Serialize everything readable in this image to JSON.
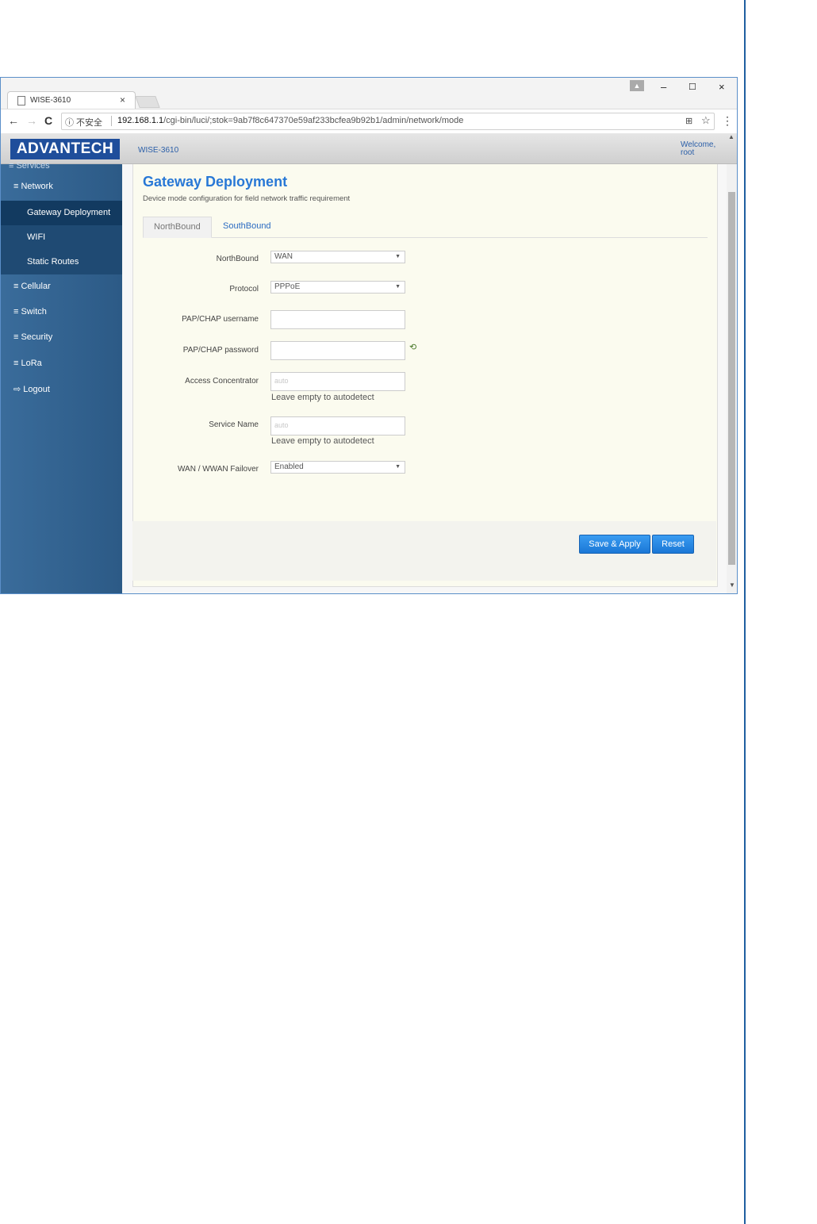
{
  "browser": {
    "tab_title": "WISE-3610",
    "tab_close": "×",
    "nav": {
      "back": "←",
      "forward": "→",
      "reload": "C"
    },
    "security_label": "ⓘ 不安全",
    "url_host": "192.168.1.1",
    "url_path": "/cgi-bin/luci/;stok=9ab7f8c647370e59af233bcfea9b92b1/admin/network/mode",
    "window_controls": {
      "minimize": "–",
      "maximize": "☐",
      "close": "×"
    },
    "menu_glyph": "⋮",
    "star_glyph": "☆",
    "translate_glyph": "⊞"
  },
  "header": {
    "logo": "ADVANTECH",
    "hostname": "WISE-3610",
    "welcome_line1": "Welcome,",
    "welcome_line2": "root"
  },
  "sidebar": {
    "cut_item": "≡ Services",
    "items": [
      {
        "label": "≡ Network"
      },
      {
        "label": "Gateway Deployment"
      },
      {
        "label": "WIFI"
      },
      {
        "label": "Static Routes"
      },
      {
        "label": "≡ Cellular"
      },
      {
        "label": "≡ Switch"
      },
      {
        "label": "≡ Security"
      },
      {
        "label": "≡ LoRa"
      },
      {
        "label": "⇨ Logout"
      }
    ]
  },
  "page": {
    "title": "Gateway Deployment",
    "description": "Device mode configuration for field network traffic requirement",
    "tabs": [
      {
        "label": "NorthBound"
      },
      {
        "label": "SouthBound"
      }
    ]
  },
  "form": {
    "northbound": {
      "label": "NorthBound",
      "value": "WAN"
    },
    "protocol": {
      "label": "Protocol",
      "value": "PPPoE"
    },
    "username": {
      "label": "PAP/CHAP username",
      "value": ""
    },
    "password": {
      "label": "PAP/CHAP password",
      "value": ""
    },
    "access_concentrator": {
      "label": "Access Concentrator",
      "placeholder": "auto",
      "hint": "Leave empty to autodetect"
    },
    "service_name": {
      "label": "Service Name",
      "placeholder": "auto",
      "hint": "Leave empty to autodetect"
    },
    "failover": {
      "label": "WAN / WWAN Failover",
      "value": "Enabled"
    }
  },
  "actions": {
    "save_apply": "Save & Apply",
    "reset": "Reset"
  }
}
